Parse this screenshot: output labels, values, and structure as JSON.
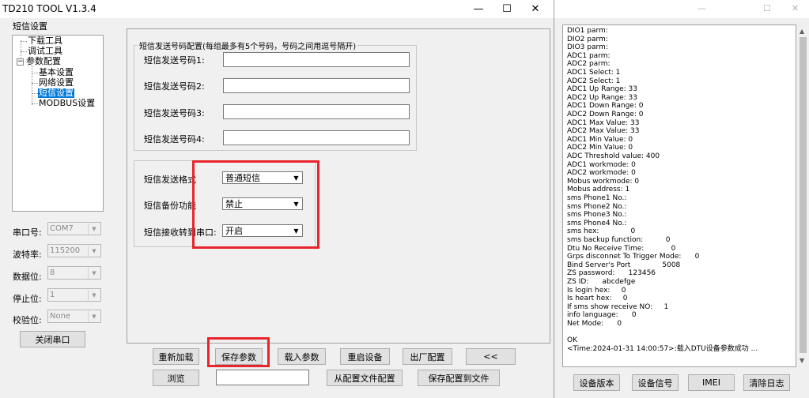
{
  "window": {
    "title": "TD210 TOOL V1.3.4",
    "minimize_glyph": "—",
    "maximize_glyph": "☐",
    "close_glyph": "✕"
  },
  "left": {
    "tree_header": "短信设置",
    "tree": {
      "download": "下载工具",
      "debug": "调试工具",
      "param_config": "参数配置",
      "basic": "基本设置",
      "network": "网络设置",
      "sms": "短信设置",
      "modbus": "MODBUS设置"
    },
    "serial": {
      "port_label": "串口号:",
      "port_value": "COM7",
      "baud_label": "波特率:",
      "baud_value": "115200",
      "databits_label": "数据位:",
      "databits_value": "8",
      "stopbits_label": "停止位:",
      "stopbits_value": "1",
      "parity_label": "校验位:",
      "parity_value": "None",
      "close_button": "关闭串口"
    }
  },
  "sms": {
    "group_title": "短信发送号码配置(每组最多有5个号码，号码之间用逗号隔开)",
    "phone1_label": "短信发送号码1:",
    "phone2_label": "短信发送号码2:",
    "phone3_label": "短信发送号码3:",
    "phone4_label": "短信发送号码4:",
    "phone1_value": "",
    "phone2_value": "",
    "phone3_value": "",
    "phone4_value": "",
    "format_label": "短信发送格式",
    "format_value": "普通短信",
    "backup_label": "短信备份功能",
    "backup_value": "禁止",
    "receive_label": "短信接收转到串口:",
    "receive_value": "开启"
  },
  "buttons": {
    "reload": "重新加载",
    "save_params": "保存参数",
    "load_params": "载入参数",
    "restart": "重启设备",
    "factory": "出厂配置",
    "collapse": "<<",
    "browse": "浏览",
    "browse_path": "",
    "from_file": "从配置文件配置",
    "save_to_file": "保存配置到文件"
  },
  "log_lines": [
    "DIO1 parm:",
    "DIO2 parm:",
    "DIO3 parm:",
    "ADC1 parm:",
    "ADC2 parm:",
    "ADC1 Select: 1",
    "ADC2 Select: 1",
    "ADC1 Up Range: 33",
    "ADC2 Up Range: 33",
    "ADC1 Down Range: 0",
    "ADC2 Down Range: 0",
    "ADC1 Max Value: 33",
    "ADC2 Max Value: 33",
    "ADC1 Min Value: 0",
    "ADC2 Min Value: 0",
    "ADC Threshold value: 400",
    "ADC1 workmode: 0",
    "ADC2 workmode: 0",
    "Mobus workmode: 0",
    "Mobus address: 1",
    "sms Phone1 No.:",
    "sms Phone2 No.:",
    "sms Phone3 No.:",
    "sms Phone4 No.:",
    "sms hex:              0",
    "sms backup function:          0",
    "Dtu No Receive Time:            0",
    "Grps disconnet To Trigger Mode:      0",
    "Bind Server's Port              5008",
    "ZS password:      123456",
    "ZS ID:      abcdefge",
    "Is login hex:     0",
    "Is heart hex:     0",
    "If sms show receive NO:     1",
    "info language:      0",
    "Net Mode:      0",
    "",
    "OK",
    "<Time:2024-01-31 14:00:57>:载入DTU设备参数成功 ..."
  ],
  "right_buttons": {
    "version": "设备版本",
    "signal": "设备信号",
    "imei": "IMEI",
    "clear_log": "清除日志"
  }
}
